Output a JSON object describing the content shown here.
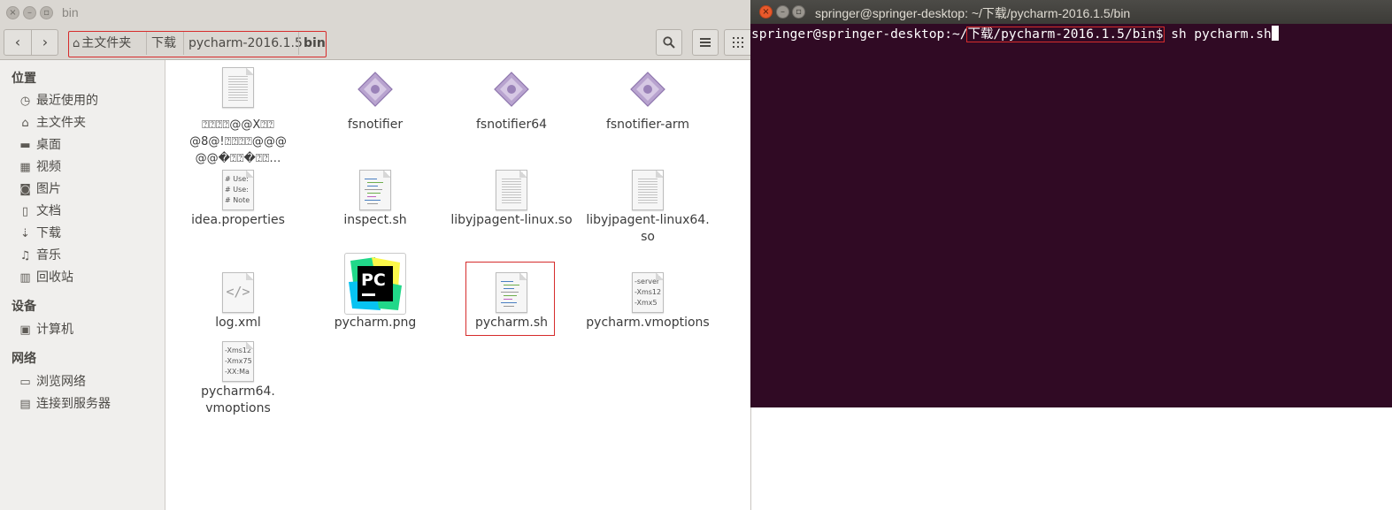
{
  "file_manager": {
    "title": "bin",
    "breadcrumbs": [
      "主文件夹",
      "下载",
      "pycharm-2016.1.5",
      "bin"
    ],
    "sidebar": {
      "places_heading": "位置",
      "places": [
        {
          "label": "最近使用的",
          "icon": "clock-icon"
        },
        {
          "label": "主文件夹",
          "icon": "home-icon"
        },
        {
          "label": "桌面",
          "icon": "desktop-icon"
        },
        {
          "label": "视频",
          "icon": "video-icon"
        },
        {
          "label": "图片",
          "icon": "camera-icon"
        },
        {
          "label": "文档",
          "icon": "document-icon"
        },
        {
          "label": "下载",
          "icon": "download-icon"
        },
        {
          "label": "音乐",
          "icon": "music-icon"
        },
        {
          "label": "回收站",
          "icon": "trash-icon"
        }
      ],
      "devices_heading": "设备",
      "devices": [
        {
          "label": "计算机",
          "icon": "computer-icon"
        }
      ],
      "network_heading": "网络",
      "network": [
        {
          "label": "浏览网络",
          "icon": "network-icon"
        },
        {
          "label": "连接到服务器",
          "icon": "server-icon"
        }
      ]
    },
    "files": [
      {
        "name": "⍰⍰⍰⍰⍰\n@8@!⍰⍰⍰@@@\n@@�⍰⍰⍰⍰…",
        "display_lines": [
          "⍰⍰⍰⍰@@X⍰⍰",
          "@8@!⍰⍰⍰⍰@@@",
          "@@�⍰⍰�⍰⍰…"
        ],
        "icon": "text-file-icon"
      },
      {
        "name": "fsnotifier",
        "icon": "executable-icon"
      },
      {
        "name": "fsnotifier64",
        "icon": "executable-icon"
      },
      {
        "name": "fsnotifier-arm",
        "icon": "executable-icon"
      },
      {
        "name": "idea.properties",
        "icon": "properties-file-icon",
        "preview": [
          "# Use:",
          "# Use:",
          "# Note"
        ]
      },
      {
        "name": "inspect.sh",
        "icon": "shell-script-icon"
      },
      {
        "name": "libyjpagent-linux.so",
        "icon": "library-file-icon"
      },
      {
        "name": "libyjpagent-linux64.so",
        "icon": "library-file-icon"
      },
      {
        "name": "log.xml",
        "icon": "xml-file-icon"
      },
      {
        "name": "pycharm.png",
        "icon": "pycharm-logo-icon"
      },
      {
        "name": "pycharm.sh",
        "icon": "shell-script-icon"
      },
      {
        "name": "pycharm.vmoptions",
        "icon": "vmoptions-file-icon",
        "preview": [
          "-server",
          "-Xms12",
          "-Xmx5"
        ]
      },
      {
        "name": "pycharm64.vmoptions",
        "icon": "vmoptions-file-icon",
        "preview": [
          "-Xms12",
          "-Xmx75",
          "-XX:Ma"
        ]
      }
    ],
    "file_labels": {
      "f1": "fsnotifier",
      "f2": "fsnotifier64",
      "f3": "fsnotifier-arm",
      "f4": "idea.properties",
      "f5": "inspect.sh",
      "f6_l1": "libyjpagent-linux.so",
      "f7_l1": "libyjpagent-linux64.",
      "f7_l2": "so",
      "f8": "log.xml",
      "f9": "pycharm.png",
      "f10": "pycharm.sh",
      "f11": "pycharm.vmoptions",
      "f12_l1": "pycharm64.",
      "f12_l2": "vmoptions",
      "f0_l1": "⍰⍰⍰⍰@@X⍰⍰",
      "f0_l2": "@8@!⍰⍰⍰⍰@@@",
      "f0_l3": "@@�⍰⍰�⍰⍰…"
    },
    "pc_logo_text": "PC"
  },
  "terminal": {
    "title": "springer@springer-desktop: ~/下载/pycharm-2016.1.5/bin",
    "prompt_prefix": "springer@springer-desktop:~/",
    "prompt_path": "下载/pycharm-2016.1.5/bin$",
    "command": " sh pycharm.sh"
  },
  "colors": {
    "terminal_bg": "#300a24",
    "highlight_box": "#d62c2c",
    "titlebar": "#dad7d2"
  }
}
